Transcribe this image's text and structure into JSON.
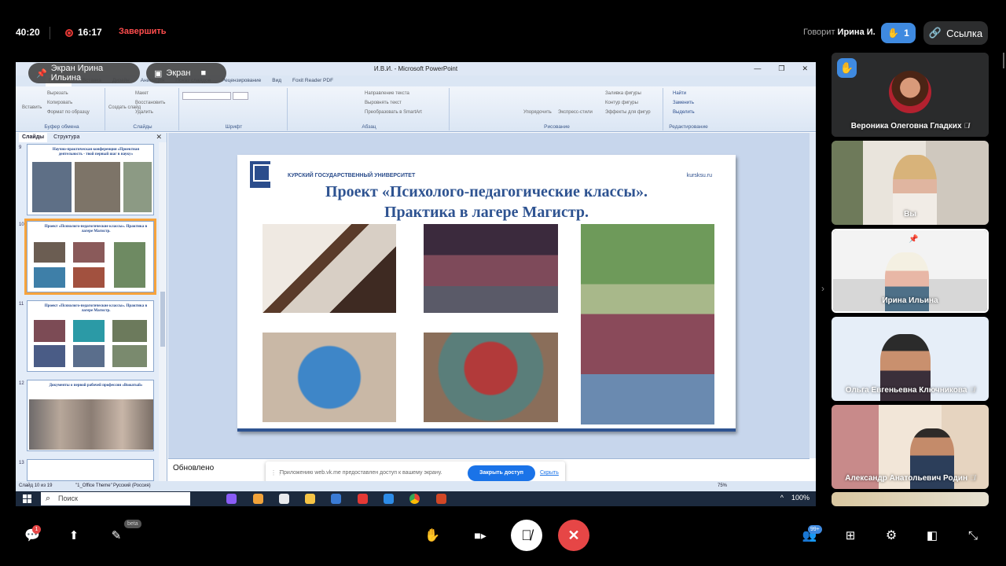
{
  "topbar": {
    "call_duration": "40:20",
    "recording_time": "16:17",
    "end_recording": "Завершить",
    "speaking_label": "Говорит",
    "speaking_name": "Ирина И.",
    "raised_hands": "1",
    "link_label": "Ссылка"
  },
  "share_overlay": {
    "screen_owner": "Экран Ирина Ильина",
    "screen_button": "Экран"
  },
  "powerpoint": {
    "window_title": "И.В.И. - Microsoft PowerPoint",
    "tabs": [
      "Главная",
      "Вставка",
      "Дизайн",
      "Анимация",
      "Показ слайдов",
      "Рецензирование",
      "Вид",
      "Foxit Reader PDF"
    ],
    "ribbon": {
      "clipboard": {
        "label": "Буфер обмена",
        "paste": "Вставить",
        "cut": "Вырезать",
        "copy": "Копировать",
        "format": "Формат по образцу"
      },
      "slides": {
        "label": "Слайды",
        "create": "Создать слайд",
        "layout": "Макет",
        "reset": "Восстановить",
        "delete": "Удалить"
      },
      "font": {
        "label": "Шрифт"
      },
      "paragraph": {
        "label": "Абзац",
        "direction": "Направление текста",
        "align": "Выровнять текст",
        "smartart": "Преобразовать в SmartArt"
      },
      "drawing": {
        "label": "Рисование",
        "arrange": "Упорядочить",
        "quick_styles": "Экспресс-стили",
        "fill": "Заливка фигуры",
        "outline": "Контур фигуры",
        "effects": "Эффекты для фигур"
      },
      "editing": {
        "label": "Редактирование",
        "find": "Найти",
        "replace": "Заменить",
        "select": "Выделить"
      }
    },
    "side_tabs": [
      "Слайды",
      "Структура"
    ],
    "thumbnails": [
      {
        "num": "9",
        "title": "Научно-практическая конференция «Проектная деятельность - твой первый шаг в науку»"
      },
      {
        "num": "10",
        "title": "Проект «Психолого-педагогические классы». Практика в лагере Магистр."
      },
      {
        "num": "11",
        "title": "Проект «Психолого-педагогические классы». Практика в лагере Магистр."
      },
      {
        "num": "12",
        "title": "Документы о первой рабочей профессии «Вожатый»"
      },
      {
        "num": "13",
        "title": ""
      }
    ],
    "slide": {
      "university": "КУРСКИЙ ГОСУДАРСТВЕННЫЙ УНИВЕРСИТЕТ",
      "site": "kursksu.ru",
      "title_line1": "Проект «Психолого-педагогические классы».",
      "title_line2": "Практика в лагере Магистр."
    },
    "notes_text": "Обновлено",
    "status": {
      "slide_of": "Слайд 10 из 19",
      "theme": "\"1_Office Theme\"",
      "language": "Русский (Россия)",
      "zoom": "75%"
    }
  },
  "notification": {
    "message": "Приложению web.vk.me предоставлен доступ к вашему экрану.",
    "stop_button": "Закрыть доступ",
    "hide_link": "Скрыть"
  },
  "taskbar": {
    "search_placeholder": "Поиск",
    "zoom": "100%"
  },
  "participants": [
    {
      "name": "Вероника Олеговна Гладких",
      "muted": true
    },
    {
      "name": "Вы",
      "muted": false
    },
    {
      "name": "Ирина Ильина",
      "muted": false
    },
    {
      "name": "Ольга Евгеньевна Ключникова",
      "muted": true
    },
    {
      "name": "Александр Анатольевич Родин",
      "muted": true
    }
  ],
  "bottombar": {
    "chat_badge": "1",
    "beta_label": "beta",
    "participants_badge": "99+"
  },
  "colors": {
    "accent": "#3f8ae0",
    "end_call": "#e64646",
    "record": "#e53935"
  }
}
